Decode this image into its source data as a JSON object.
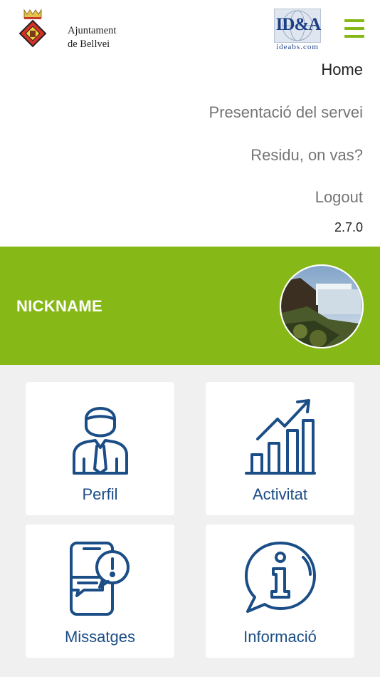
{
  "header": {
    "municipality_logo_text": [
      "Ajuntament",
      "de Bellvei"
    ],
    "partner_logo_text": "ID&A",
    "partner_logo_subtext": "ideabs.com",
    "menu_icon": "hamburger-icon",
    "brand_color": "#86b817"
  },
  "menu": {
    "items": [
      {
        "label": "Home"
      },
      {
        "label": "Presentació del servei"
      },
      {
        "label": "Residu, on vas?"
      },
      {
        "label": "Logout"
      }
    ],
    "version": "2.7.0"
  },
  "profile": {
    "nickname": "NICKNAME",
    "avatar_icon": "waterfall-photo"
  },
  "tiles": [
    {
      "label": "Perfil",
      "icon": "user-icon"
    },
    {
      "label": "Activitat",
      "icon": "chart-icon"
    },
    {
      "label": "Missatges",
      "icon": "message-icon"
    },
    {
      "label": "Informació",
      "icon": "info-icon"
    }
  ],
  "colors": {
    "icon": "#1b4d86",
    "banner": "#86b817",
    "background": "#f0f0f0"
  }
}
